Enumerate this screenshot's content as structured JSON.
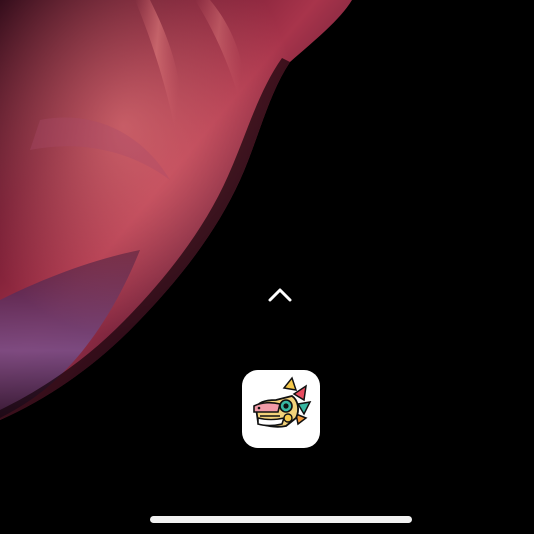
{
  "screen": {
    "background_color": "#000000"
  },
  "wallpaper": {
    "description_colors": [
      "#3a0c1e",
      "#8e2641",
      "#c65a63",
      "#6a3a7a"
    ]
  },
  "app_drawer": {
    "icon": "chevron-up-icon",
    "color": "#ffffff"
  },
  "dock": {
    "apps": [
      {
        "icon": "quetzalcoatl-dragon-head-icon",
        "background": "#ffffff"
      }
    ]
  },
  "home_indicator": {
    "color": "#f2f2f2"
  }
}
